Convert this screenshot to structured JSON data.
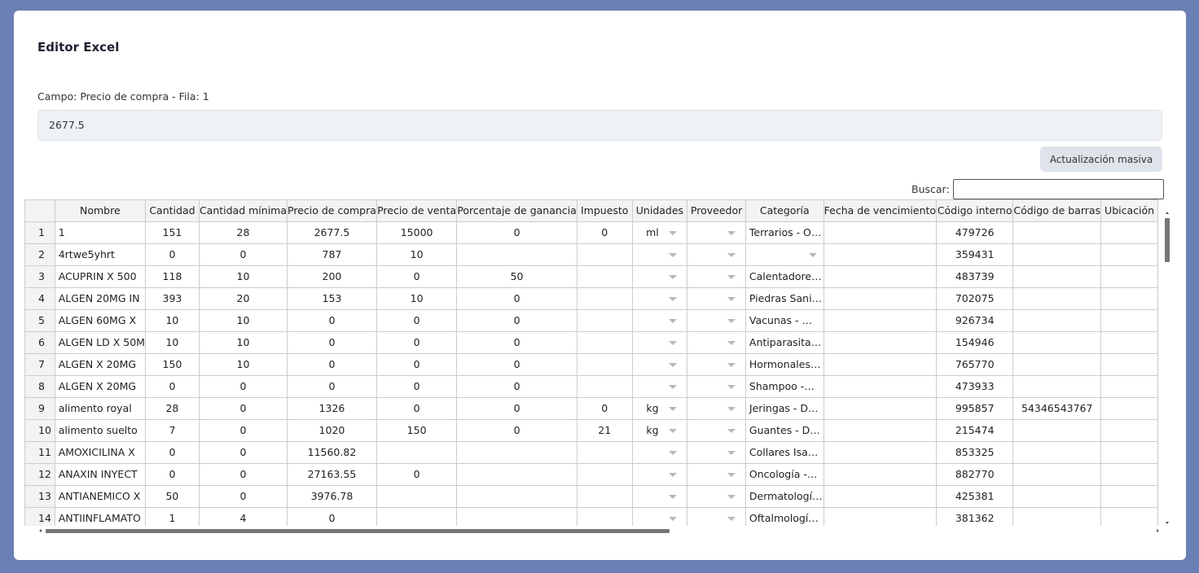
{
  "page": {
    "title": "Editor Excel",
    "field_label": "Campo: Precio de compra - Fila: 1",
    "field_value": "2677.5",
    "mass_update_label": "Actualización masiva",
    "search_label": "Buscar:",
    "search_value": ""
  },
  "table": {
    "headers": [
      "",
      "Nombre",
      "Cantidad",
      "Cantidad mínima",
      "Precio de compra",
      "Precio de venta",
      "Porcentaje de ganancia",
      "Impuesto",
      "Unidades",
      "Proveedor",
      "Categoría",
      "Fecha de vencimiento",
      "Código interno",
      "Código de barras",
      "Ubicación"
    ],
    "rows": [
      [
        "1",
        "1",
        "151",
        "28",
        "2677.5",
        "15000",
        "0",
        "0",
        "ml",
        "",
        "Terrarios - O…",
        "",
        "479726",
        "",
        ""
      ],
      [
        "2",
        "4rtwe5yhrt",
        "0",
        "0",
        "787",
        "10",
        "",
        "",
        "",
        "",
        "",
        "",
        "359431",
        "",
        ""
      ],
      [
        "3",
        "ACUPRIN X 500",
        "118",
        "10",
        "200",
        "0",
        "50",
        "",
        "",
        "",
        "Calentadore…",
        "",
        "483739",
        "",
        ""
      ],
      [
        "4",
        "ALGEN 20MG IN",
        "393",
        "20",
        "153",
        "10",
        "0",
        "",
        "",
        "",
        "Piedras Sani…",
        "",
        "702075",
        "",
        ""
      ],
      [
        "5",
        "ALGEN 60MG X",
        "10",
        "10",
        "0",
        "0",
        "0",
        "",
        "",
        "",
        "Vacunas - …",
        "",
        "926734",
        "",
        ""
      ],
      [
        "6",
        "ALGEN LD X 50M",
        "10",
        "10",
        "0",
        "0",
        "0",
        "",
        "",
        "",
        "Antiparasita…",
        "",
        "154946",
        "",
        ""
      ],
      [
        "7",
        "ALGEN X 20MG",
        "150",
        "10",
        "0",
        "0",
        "0",
        "",
        "",
        "",
        "Hormonales…",
        "",
        "765770",
        "",
        ""
      ],
      [
        "8",
        "ALGEN X 20MG",
        "0",
        "0",
        "0",
        "0",
        "0",
        "",
        "",
        "",
        "Shampoo -…",
        "",
        "473933",
        "",
        ""
      ],
      [
        "9",
        "alimento royal",
        "28",
        "0",
        "1326",
        "0",
        "0",
        "0",
        "kg",
        "",
        "Jeringas - D…",
        "",
        "995857",
        "54346543767",
        ""
      ],
      [
        "10",
        "alimento suelto",
        "7",
        "0",
        "1020",
        "150",
        "0",
        "21",
        "kg",
        "",
        "Guantes - D…",
        "",
        "215474",
        "",
        ""
      ],
      [
        "11",
        "AMOXICILINA X",
        "0",
        "0",
        "11560.82",
        "",
        "",
        "",
        "",
        "",
        "Collares Isa…",
        "",
        "853325",
        "",
        ""
      ],
      [
        "12",
        "ANAXIN INYECT",
        "0",
        "0",
        "27163.55",
        "0",
        "",
        "",
        "",
        "",
        "Oncología -…",
        "",
        "882770",
        "",
        ""
      ],
      [
        "13",
        "ANTIANEMICO X",
        "50",
        "0",
        "3976.78",
        "",
        "",
        "",
        "",
        "",
        "Dermatologí…",
        "",
        "425381",
        "",
        ""
      ],
      [
        "14",
        "ANTIINFLAMATO",
        "1",
        "4",
        "0",
        "",
        "",
        "",
        "",
        "",
        "Oftalmologí…",
        "",
        "381362",
        "",
        ""
      ]
    ]
  }
}
